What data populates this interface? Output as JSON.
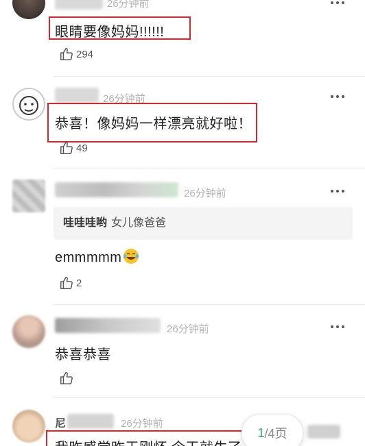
{
  "comments": [
    {
      "time": "26分钟前",
      "text": "眼睛要像妈妈!!!!!!",
      "likes": "294"
    },
    {
      "time": "26分钟前",
      "text": "恭喜！像妈妈一样漂亮就好啦！",
      "likes": "49"
    },
    {
      "time": "26分钟前",
      "quote_author": "哇哇哇哟",
      "quote_text": "女儿像爸爸",
      "text": "emmmmm",
      "emoji": "laughing-tears-emoji",
      "likes": "2"
    },
    {
      "time": "26分钟前",
      "text": "恭喜恭喜",
      "likes": ""
    },
    {
      "name_partial": "尼",
      "time": "26分钟前",
      "text": "我昨感觉昨天刚怀 今天就生了"
    }
  ],
  "pager": {
    "current": "1",
    "rest": "/4页"
  },
  "colors": {
    "highlight": "#d8262c",
    "pager_current": "#3aa75a",
    "time": "#b3b3b3"
  },
  "icons": {
    "like": "thumbs-up-icon",
    "more": "more-dots-icon"
  }
}
